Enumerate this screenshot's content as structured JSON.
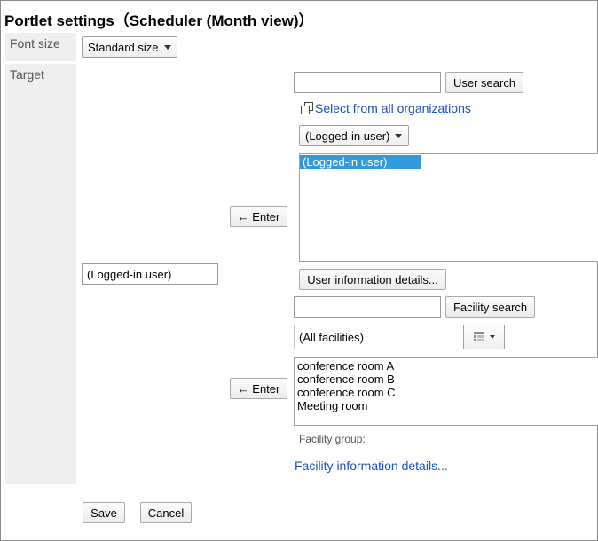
{
  "title": "Portlet settings（Scheduler (Month view)）",
  "font_size": {
    "label": "Font size",
    "selected": "Standard size"
  },
  "target": {
    "label": "Target",
    "current_value": "(Logged-in user)",
    "users": {
      "search_value": "",
      "search_button": "User search",
      "select_all_orgs_link": "Select from all organizations",
      "org_dropdown_selected": "(Logged-in user)",
      "enter_button": "← Enter",
      "list_items": [
        "(Logged-in user)"
      ],
      "details_button": "User information details..."
    },
    "facilities": {
      "search_value": "",
      "search_button": "Facility search",
      "group_dropdown_selected": "(All facilities)",
      "enter_button": "← Enter",
      "list_items": [
        "conference room A",
        "conference room B",
        "conference room C",
        "Meeting room"
      ],
      "group_label": "Facility group:",
      "details_link": "Facility information details..."
    }
  },
  "actions": {
    "save": "Save",
    "cancel": "Cancel"
  },
  "icons": {
    "select_orgs": "window-stack-icon",
    "facility_group_picker": "facility-tree-icon"
  }
}
